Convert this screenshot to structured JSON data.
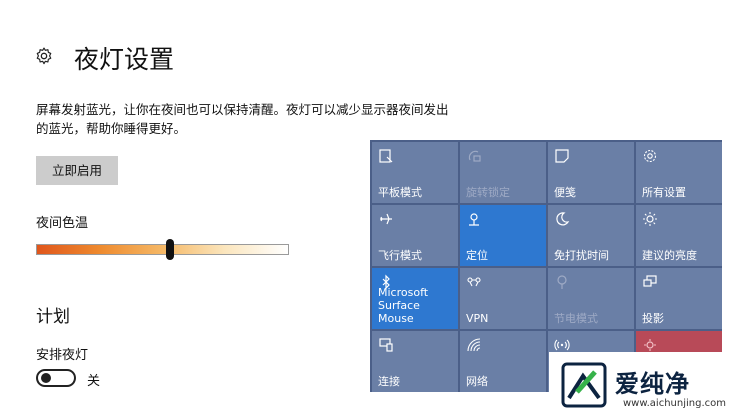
{
  "page": {
    "title": "夜灯设置",
    "description": "屏幕发射蓝光，让你在夜间也可以保持清醒。夜灯可以减少显示器夜间发出的蓝光，帮助你睡得更好。",
    "enable_now_button": "立即启用",
    "temperature_label": "夜间色温",
    "temperature_level": 0.53,
    "plan_heading": "计划",
    "schedule_label": "安排夜灯",
    "schedule_state": "关"
  },
  "action_center": {
    "tiles": [
      {
        "label": "平板模式",
        "icon": "tablet-mode-icon",
        "state": "normal"
      },
      {
        "label": "旋转锁定",
        "icon": "rotation-lock-icon",
        "state": "dim"
      },
      {
        "label": "便笺",
        "icon": "note-icon",
        "state": "normal"
      },
      {
        "label": "所有设置",
        "icon": "gear-icon",
        "state": "normal"
      },
      {
        "label": "飞行模式",
        "icon": "airplane-icon",
        "state": "normal"
      },
      {
        "label": "定位",
        "icon": "location-icon",
        "state": "active"
      },
      {
        "label": "免打扰时间",
        "icon": "moon-icon",
        "state": "normal"
      },
      {
        "label": "建议的亮度",
        "icon": "sun-icon",
        "state": "normal"
      },
      {
        "label": "Microsoft\nSurface Mouse",
        "icon": "bluetooth-icon",
        "state": "active"
      },
      {
        "label": "VPN",
        "icon": "vpn-icon",
        "state": "normal"
      },
      {
        "label": "节电模式",
        "icon": "battery-saver-icon",
        "state": "dim"
      },
      {
        "label": "投影",
        "icon": "project-icon",
        "state": "normal"
      },
      {
        "label": "连接",
        "icon": "connect-icon",
        "state": "normal"
      },
      {
        "label": "网络",
        "icon": "network-icon",
        "state": "normal"
      },
      {
        "label": "",
        "icon": "hotspot-icon",
        "state": "normal"
      },
      {
        "label": "",
        "icon": "night-light-icon",
        "state": "red"
      }
    ]
  },
  "watermark": {
    "name": "爱纯净",
    "url": "www.aichunjing.com"
  }
}
